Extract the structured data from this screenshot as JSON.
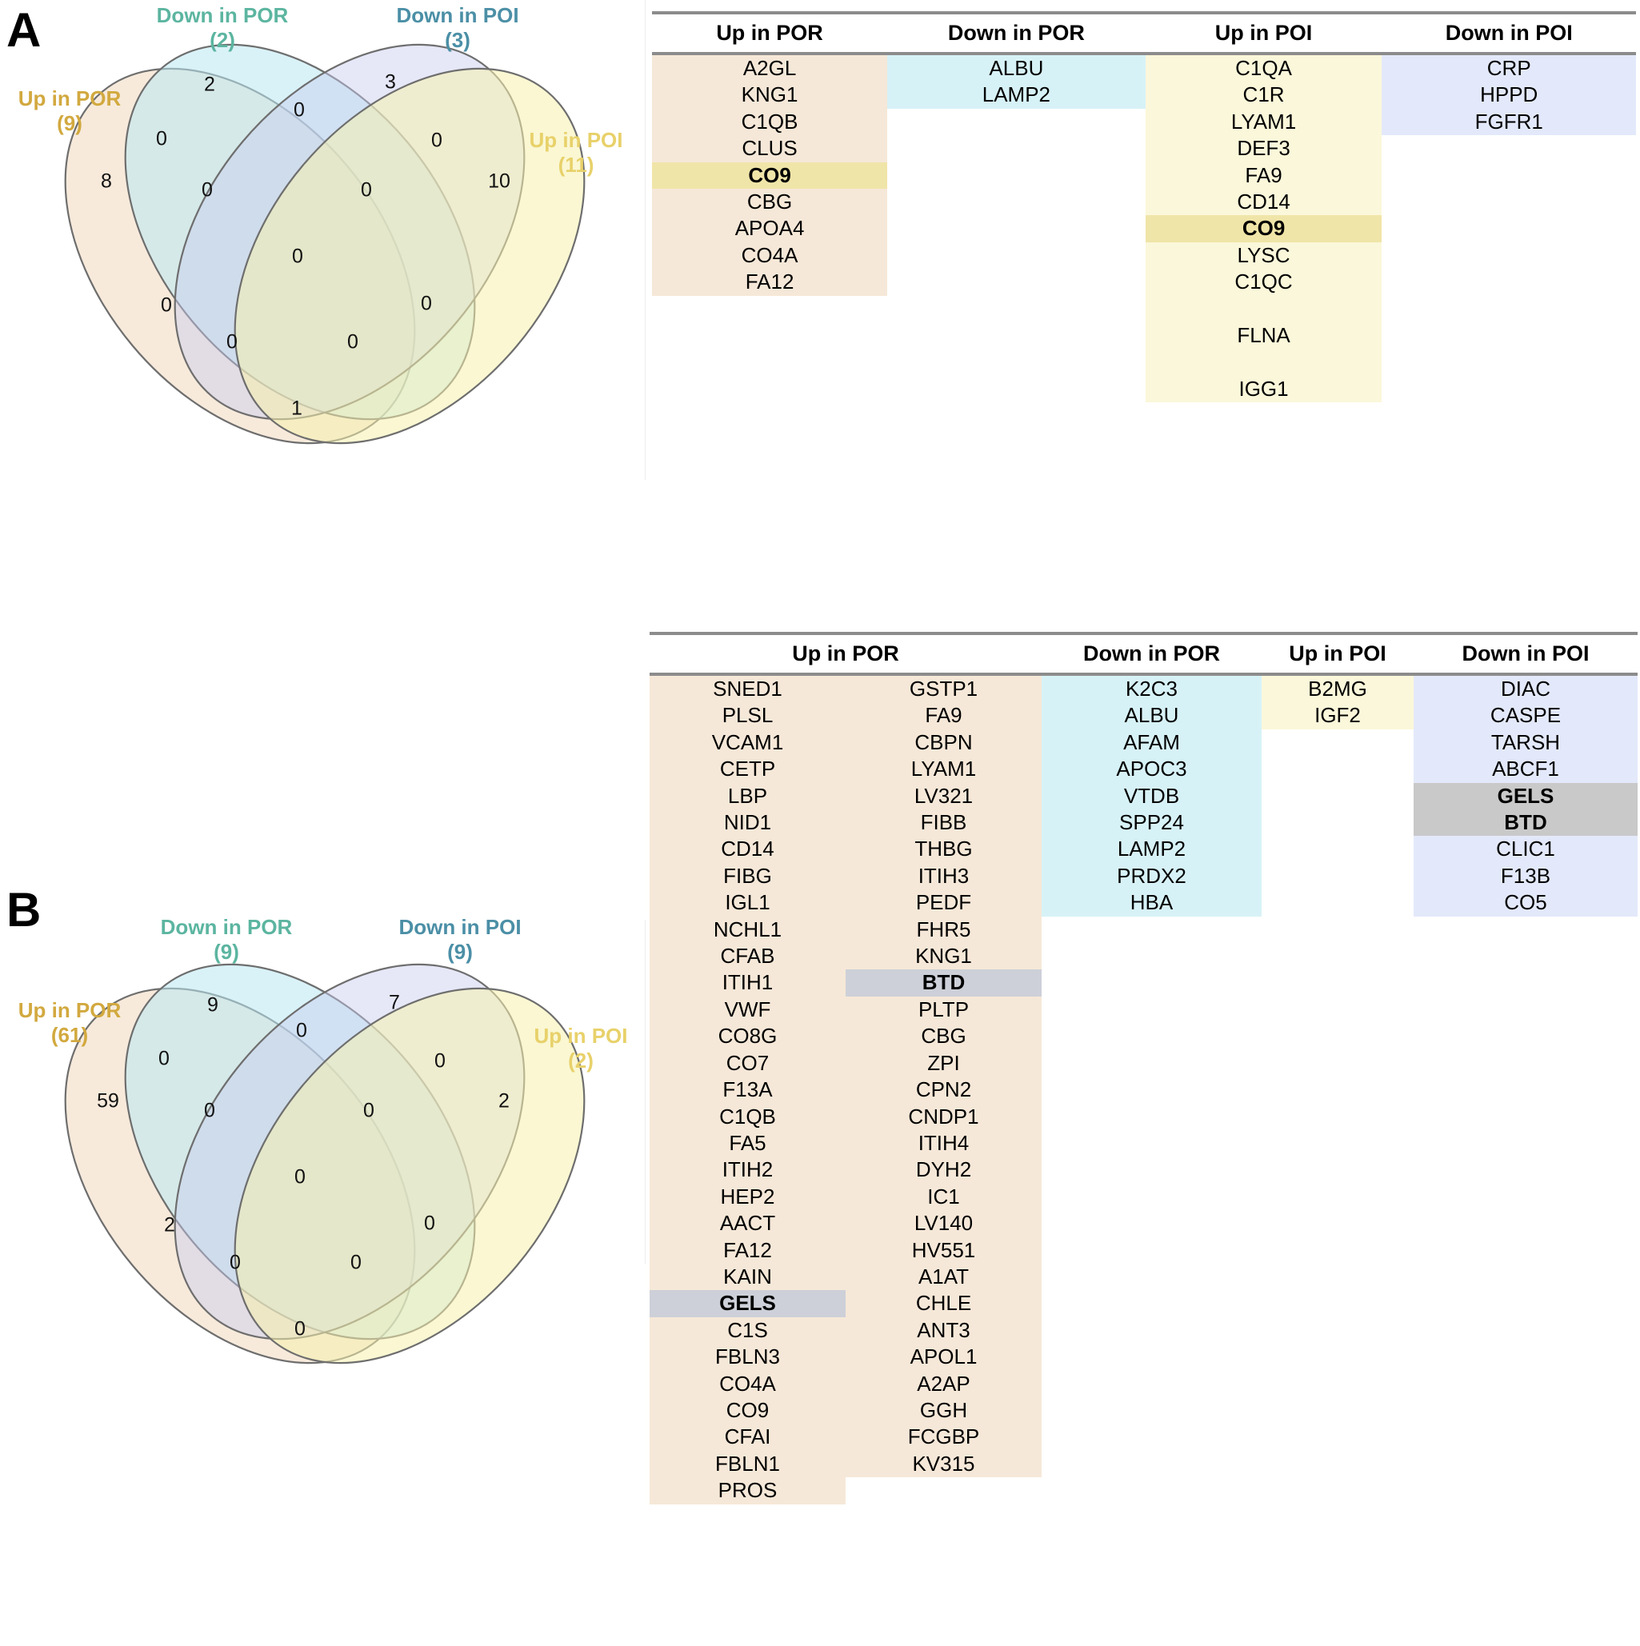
{
  "panels": {
    "a": {
      "letter": "A",
      "venn": {
        "labels": {
          "up_por": {
            "name": "Up in POR",
            "count": "(9)"
          },
          "down_por": {
            "name": "Down in POR",
            "count": "(2)"
          },
          "down_poi": {
            "name": "Down in POI",
            "count": "(3)"
          },
          "up_poi": {
            "name": "Up in POI",
            "count": "(11)"
          }
        },
        "regions": {
          "up_por_only": "8",
          "down_por_only": "2",
          "down_poi_only": "3",
          "up_poi_only": "10",
          "upor_dpor": "0",
          "dpor_dpoi": "0",
          "dpoi_upoi": "0",
          "upor_dpoi": "0",
          "dpor_upoi": "0",
          "upor_upoi": "1",
          "upor_dpor_dpoi": "0",
          "dpor_dpoi_upoi": "0",
          "upor_dpor_upoi": "0",
          "upor_dpoi_upoi": "0",
          "all_four": "0"
        }
      },
      "table": {
        "headers": [
          "Up in POR",
          "Down in POR",
          "Up in POI",
          "Down in POI"
        ],
        "up_por": [
          "A2GL",
          "KNG1",
          "C1QB",
          "CLUS",
          "CO9",
          "CBG",
          "APOA4",
          "CO4A",
          "FA12"
        ],
        "down_por": [
          "ALBU",
          "LAMP2"
        ],
        "up_poi": [
          "C1QA",
          "C1R",
          "LYAM1",
          "DEF3",
          "FA9",
          "CD14",
          "CO9",
          "LYSC",
          "C1QC",
          "",
          "FLNA",
          "",
          "IGG1"
        ],
        "down_poi": [
          "CRP",
          "HPPD",
          "FGFR1"
        ],
        "highlight": [
          "CO9"
        ]
      }
    },
    "b": {
      "letter": "B",
      "venn": {
        "labels": {
          "up_por": {
            "name": "Up in POR",
            "count": "(61)"
          },
          "down_por": {
            "name": "Down in POR",
            "count": "(9)"
          },
          "down_poi": {
            "name": "Down in POI",
            "count": "(9)"
          },
          "up_poi": {
            "name": "Up in POI",
            "count": "(2)"
          }
        },
        "regions": {
          "up_por_only": "59",
          "down_por_only": "9",
          "down_poi_only": "7",
          "up_poi_only": "2",
          "upor_dpor": "0",
          "dpor_dpoi": "0",
          "dpoi_upoi": "0",
          "upor_dpoi": "2",
          "dpor_upoi": "0",
          "upor_upoi": "0",
          "upor_dpor_dpoi": "0",
          "dpor_dpoi_upoi": "0",
          "upor_dpor_upoi": "0",
          "upor_dpoi_upoi": "0",
          "all_four": "0"
        }
      },
      "table": {
        "headers": [
          "Up in POR",
          "Down in POR",
          "Up in POI",
          "Down in POI"
        ],
        "up_por_col1": [
          "SNED1",
          "PLSL",
          "VCAM1",
          "CETP",
          "LBP",
          "NID1",
          "CD14",
          "FIBG",
          "IGL1",
          "NCHL1",
          "CFAB",
          "ITIH1",
          "VWF",
          "CO8G",
          "CO7",
          "F13A",
          "C1QB",
          "FA5",
          "ITIH2",
          "HEP2",
          "AACT",
          "FA12",
          "KAIN",
          "GELS",
          "C1S",
          "FBLN3",
          "CO4A",
          "CO9",
          "CFAI",
          "FBLN1",
          "PROS"
        ],
        "up_por_col2": [
          "GSTP1",
          "FA9",
          "CBPN",
          "LYAM1",
          "LV321",
          "FIBB",
          "THBG",
          "ITIH3",
          "PEDF",
          "FHR5",
          "KNG1",
          "BTD",
          "PLTP",
          "CBG",
          "ZPI",
          "CPN2",
          "CNDP1",
          "ITIH4",
          "DYH2",
          "IC1",
          "LV140",
          "HV551",
          "A1AT",
          "CHLE",
          "ANT3",
          "APOL1",
          "A2AP",
          "GGH",
          "FCGBP",
          "KV315"
        ],
        "down_por": [
          "K2C3",
          "ALBU",
          "AFAM",
          "APOC3",
          "VTDB",
          "SPP24",
          "LAMP2",
          "PRDX2",
          "HBA"
        ],
        "up_poi": [
          "B2MG",
          "IGF2"
        ],
        "down_poi": [
          "DIAC",
          "CASPE",
          "TARSH",
          "ABCF1",
          "GELS",
          "BTD",
          "CLIC1",
          "F13B",
          "CO5"
        ],
        "highlight": [
          "GELS",
          "BTD"
        ]
      }
    }
  },
  "colors": {
    "up_por_label": "#d2a93f",
    "down_por_label": "#5cb5a0",
    "down_poi_label": "#4b8fa6",
    "up_poi_label": "#e8d16a",
    "fill_up_por": "#f6e8d8",
    "fill_down_por": "#d7f2f7",
    "fill_up_poi": "#fbf7da",
    "fill_down_poi": "#e3e9fa",
    "highlight_yellow": "#f0e5a8",
    "highlight_grey": "#cdd0d8",
    "venn_stroke": "#6e6e6e"
  }
}
